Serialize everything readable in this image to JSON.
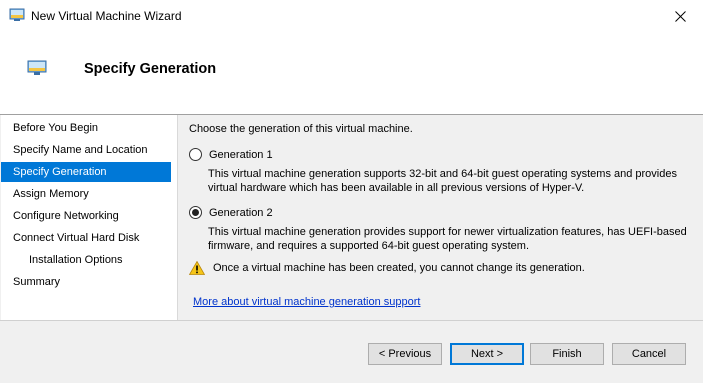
{
  "window": {
    "title": "New Virtual Machine Wizard",
    "close_glyph": "✕"
  },
  "header": {
    "title": "Specify Generation",
    "icon": "vm-monitor-icon"
  },
  "sidebar": {
    "items": [
      {
        "label": "Before You Begin"
      },
      {
        "label": "Specify Name and Location"
      },
      {
        "label": "Specify Generation",
        "active": true
      },
      {
        "label": "Assign Memory"
      },
      {
        "label": "Configure Networking"
      },
      {
        "label": "Connect Virtual Hard Disk"
      },
      {
        "label": "Installation Options",
        "sub": true
      },
      {
        "label": "Summary"
      }
    ]
  },
  "main": {
    "intro": "Choose the generation of this virtual machine.",
    "options": [
      {
        "label": "Generation 1",
        "checked": false,
        "description": "This virtual machine generation supports 32-bit and 64-bit guest operating systems and provides virtual hardware which has been available in all previous versions of Hyper-V."
      },
      {
        "label": "Generation 2",
        "checked": true,
        "description": "This virtual machine generation provides support for newer virtualization features, has UEFI-based firmware, and requires a supported 64-bit guest operating system."
      }
    ],
    "warning": "Once a virtual machine has been created, you cannot change its generation.",
    "help_link": "More about virtual machine generation support"
  },
  "buttons": {
    "previous": "< Previous",
    "next": "Next >",
    "finish": "Finish",
    "cancel": "Cancel"
  },
  "colors": {
    "accent": "#0078d7",
    "link": "#0033cc",
    "warning": "#f5c518"
  }
}
